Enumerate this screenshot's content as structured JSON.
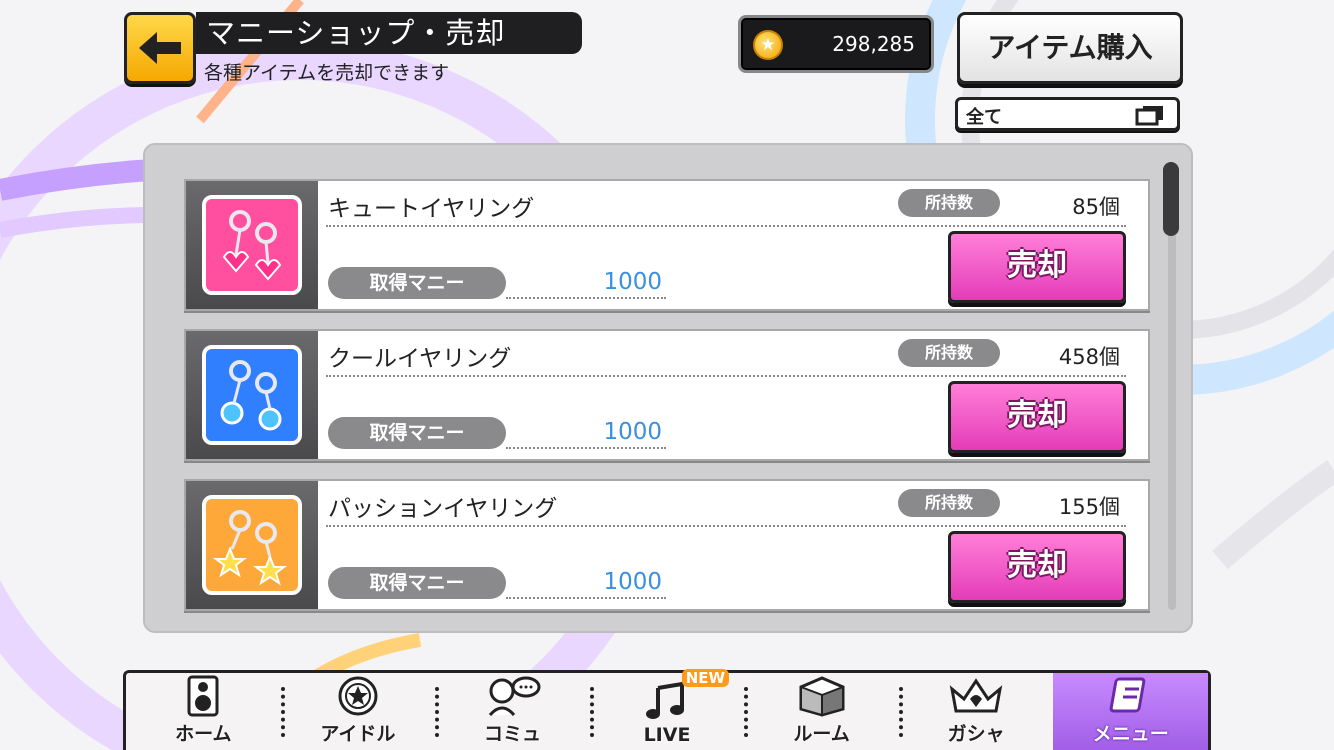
{
  "header": {
    "title": "マニーショップ・売却",
    "subtitle": "各種アイテムを売却できます",
    "money": "298,285",
    "buy_button": "アイテム購入",
    "filter_label": "全て"
  },
  "items": [
    {
      "name": "キュートイヤリング",
      "own_label": "所持数",
      "own_count": "85個",
      "get_label": "取得マニー",
      "get_value": "1000",
      "sell_label": "売却",
      "color": "#ff4f9e"
    },
    {
      "name": "クールイヤリング",
      "own_label": "所持数",
      "own_count": "458個",
      "get_label": "取得マニー",
      "get_value": "1000",
      "sell_label": "売却",
      "color": "#2f7fff"
    },
    {
      "name": "パッションイヤリング",
      "own_label": "所持数",
      "own_count": "155個",
      "get_label": "取得マニー",
      "get_value": "1000",
      "sell_label": "売却",
      "color": "#ffa83a"
    }
  ],
  "nav": {
    "home": "ホーム",
    "idol": "アイドル",
    "commu": "コミュ",
    "live": "LIVE",
    "new_badge": "NEW",
    "room": "ルーム",
    "gacha": "ガシャ",
    "menu": "メニュー"
  },
  "icons": {
    "back": "arrow-left-icon",
    "coin": "coin-icon",
    "filter": "window-icon"
  }
}
